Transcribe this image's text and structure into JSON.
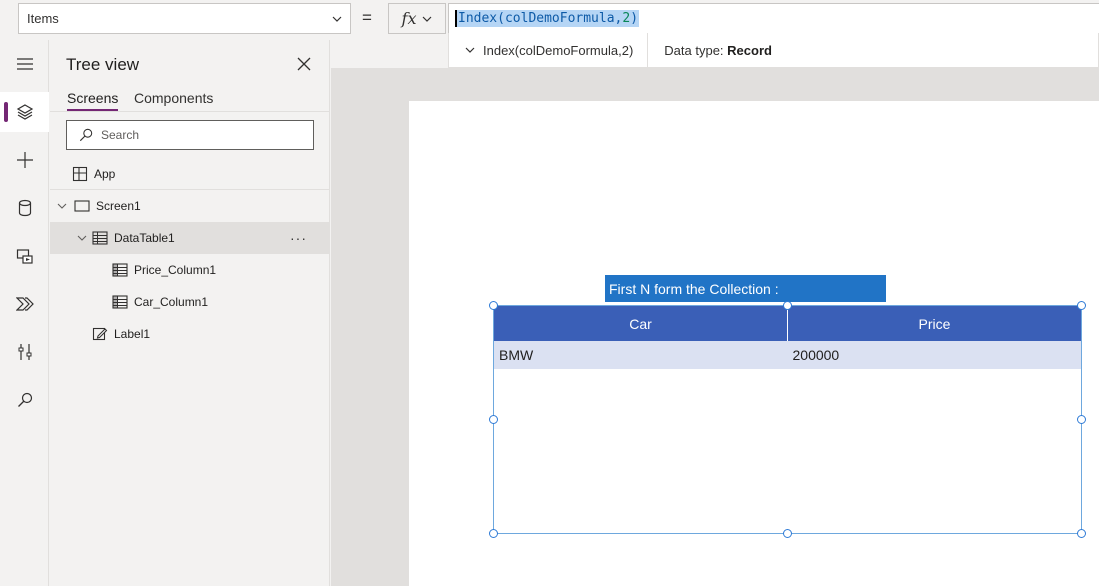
{
  "formula_bar": {
    "property": "Items",
    "equals": "=",
    "fx_label": "fx",
    "formula_prefix": "Index(colDemoFormula,",
    "formula_number": "2",
    "formula_suffix": ")",
    "hint_expression": "Index(colDemoFormula,2)",
    "hint_type_label": "Data type:",
    "hint_type_value": "Record"
  },
  "rail": {
    "items": [
      "menu-icon",
      "layers-icon",
      "add-icon",
      "data-icon",
      "media-icon",
      "power-automate-icon",
      "tools-icon",
      "search-icon"
    ],
    "active": "layers-icon"
  },
  "tree": {
    "title": "Tree view",
    "tabs": [
      "Screens",
      "Components"
    ],
    "search_placeholder": "Search",
    "items": [
      {
        "label": "App"
      },
      {
        "label": "Screen1"
      },
      {
        "label": "DataTable1"
      },
      {
        "label": "Price_Column1"
      },
      {
        "label": "Car_Column1"
      },
      {
        "label": "Label1"
      }
    ],
    "more": "···"
  },
  "canvas": {
    "label_text": "First N form the Collection :",
    "table": {
      "columns": [
        "Car",
        "Price"
      ],
      "rows": [
        [
          "BMW",
          "200000"
        ]
      ]
    }
  },
  "colors": {
    "accent": "#742774",
    "table_header": "#3a5fb7",
    "table_row": "#dbe1f2",
    "label_bg": "#2174c6",
    "selection": "#2f7bd6"
  }
}
